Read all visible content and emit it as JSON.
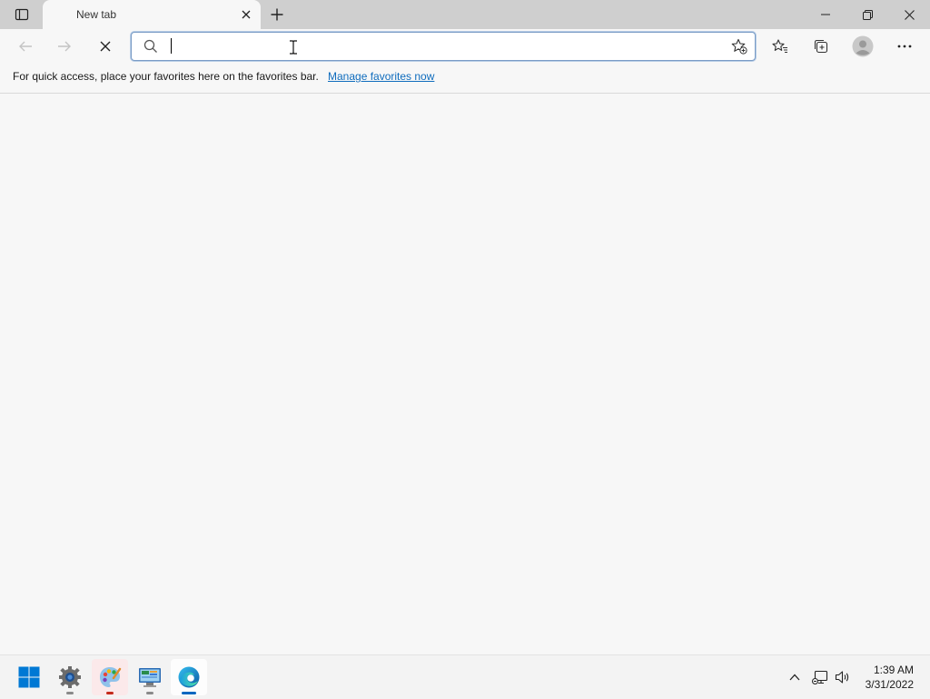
{
  "browser": {
    "tab": {
      "title": "New tab"
    },
    "address_bar": {
      "value": "",
      "placeholder": ""
    },
    "favorites_bar": {
      "message": "For quick access, place your favorites here on the favorites bar.",
      "link": "Manage favorites now"
    },
    "icons": {
      "tab_actions": "tab-actions-icon",
      "close_tab": "close-icon",
      "new_tab": "plus-icon",
      "minimize": "minimize-icon",
      "restore": "restore-icon",
      "close_window": "close-icon",
      "back": "back-arrow-icon",
      "forward": "forward-arrow-icon",
      "stop": "stop-icon",
      "search": "search-icon",
      "add_favorite": "star-plus-icon",
      "favorites": "favorites-icon",
      "collections": "collections-icon",
      "profile": "profile-icon",
      "more": "more-icon"
    }
  },
  "taskbar": {
    "apps": [
      {
        "name": "Start",
        "icon": "windows-logo-icon"
      },
      {
        "name": "Settings",
        "icon": "gear-icon"
      },
      {
        "name": "Paint",
        "icon": "paint-palette-icon"
      },
      {
        "name": "Control Panel",
        "icon": "control-panel-icon"
      },
      {
        "name": "Microsoft Edge",
        "icon": "edge-icon",
        "active": true
      }
    ],
    "tray": {
      "icons": [
        "chevron-up-icon",
        "network-icon",
        "volume-icon"
      ],
      "time": "1:39 AM",
      "date": "3/31/2022"
    }
  },
  "colors": {
    "tabstrip": "#cfcfcf",
    "page_bg": "#f7f7f7",
    "link": "#0f6cbd",
    "edge_blue": "#0078d4",
    "windows_blue": "#0078d4"
  }
}
